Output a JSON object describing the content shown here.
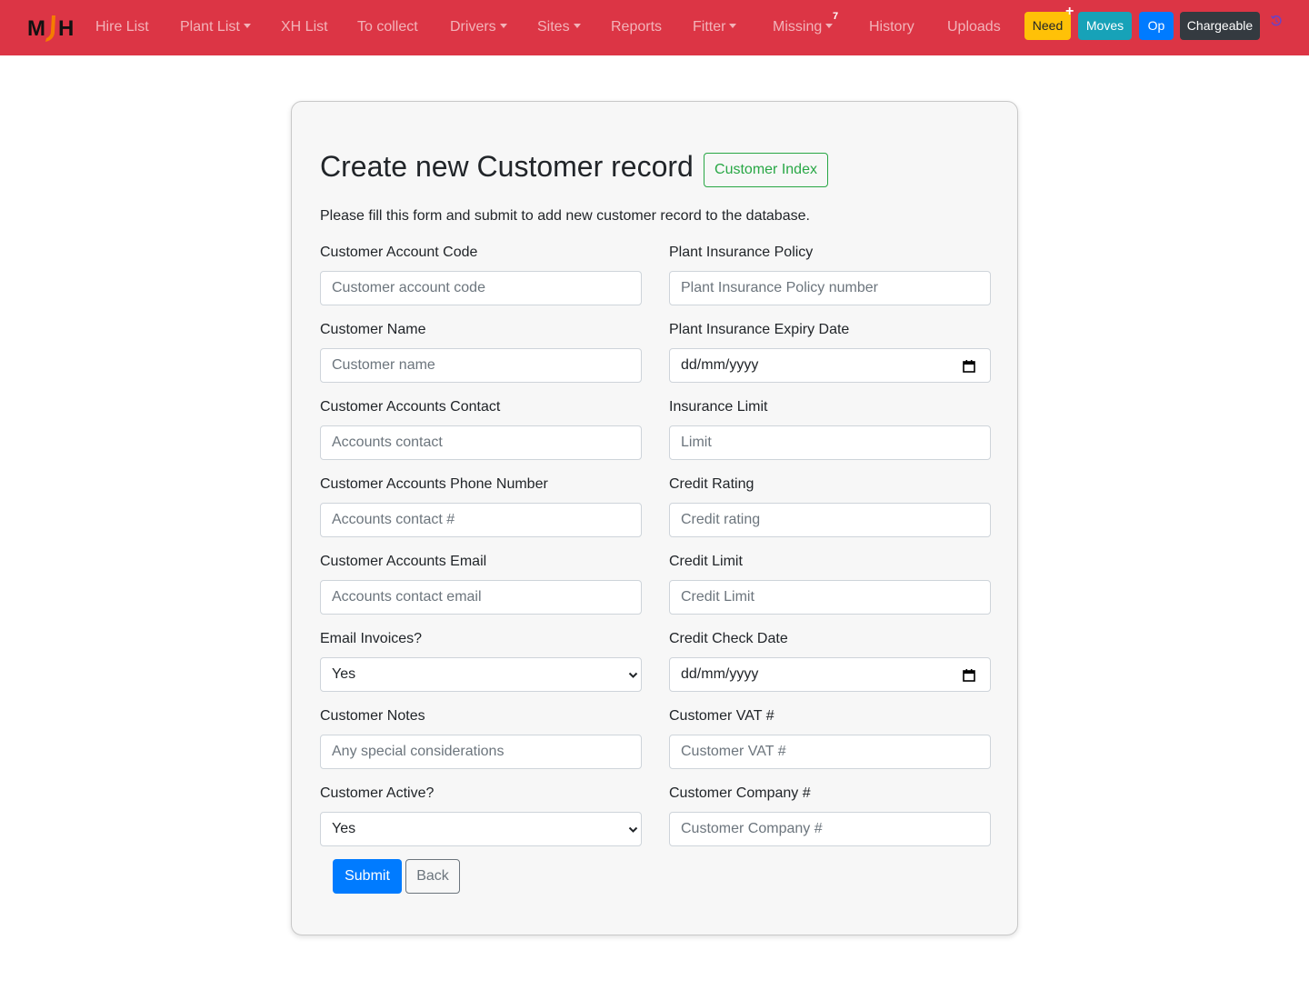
{
  "nav": {
    "logo_text": "MJH",
    "links": {
      "hire_list": "Hire List",
      "plant_list": "Plant List",
      "xh_list": "XH List",
      "to_collect": "To collect",
      "drivers": "Drivers",
      "sites": "Sites",
      "reports": "Reports",
      "fitter": "Fitter",
      "missing": "Missing",
      "history": "History",
      "uploads": "Uploads"
    },
    "missing_badge": "7",
    "buttons": {
      "need": "Need",
      "moves": "Moves",
      "op": "Op",
      "chargeable": "Chargeable"
    },
    "colors": {
      "navbar": "#dc3545",
      "need": "#ffc107",
      "moves": "#17a2b8",
      "op": "#007bff",
      "chargeable": "#343a40"
    }
  },
  "form": {
    "title": "Create new Customer record",
    "index_button": "Customer Index",
    "intro": "Please fill this form and submit to add new customer record to the database.",
    "left": {
      "account_code": {
        "label": "Customer Account Code",
        "placeholder": "Customer account code"
      },
      "name": {
        "label": "Customer Name",
        "placeholder": "Customer name"
      },
      "accounts_contact": {
        "label": "Customer Accounts Contact",
        "placeholder": "Accounts contact"
      },
      "accounts_phone": {
        "label": "Customer Accounts Phone Number",
        "placeholder": "Accounts contact #"
      },
      "accounts_email": {
        "label": "Customer Accounts Email",
        "placeholder": "Accounts contact email"
      },
      "email_invoices": {
        "label": "Email Invoices?",
        "value": "Yes"
      },
      "notes": {
        "label": "Customer Notes",
        "placeholder": "Any special considerations"
      },
      "active": {
        "label": "Customer Active?",
        "value": "Yes"
      }
    },
    "right": {
      "insurance_policy": {
        "label": "Plant Insurance Policy",
        "placeholder": "Plant Insurance Policy number"
      },
      "insurance_expiry": {
        "label": "Plant Insurance Expiry Date",
        "placeholder": "dd/mm/yyyy"
      },
      "insurance_limit": {
        "label": "Insurance Limit",
        "placeholder": "Limit"
      },
      "credit_rating": {
        "label": "Credit Rating",
        "placeholder": "Credit rating"
      },
      "credit_limit": {
        "label": "Credit Limit",
        "placeholder": "Credit Limit"
      },
      "credit_check_date": {
        "label": "Credit Check Date",
        "placeholder": "dd/mm/yyyy"
      },
      "vat": {
        "label": "Customer VAT #",
        "placeholder": "Customer VAT #"
      },
      "company_number": {
        "label": "Customer Company #",
        "placeholder": "Customer Company #"
      }
    },
    "submit": "Submit",
    "back": "Back"
  }
}
